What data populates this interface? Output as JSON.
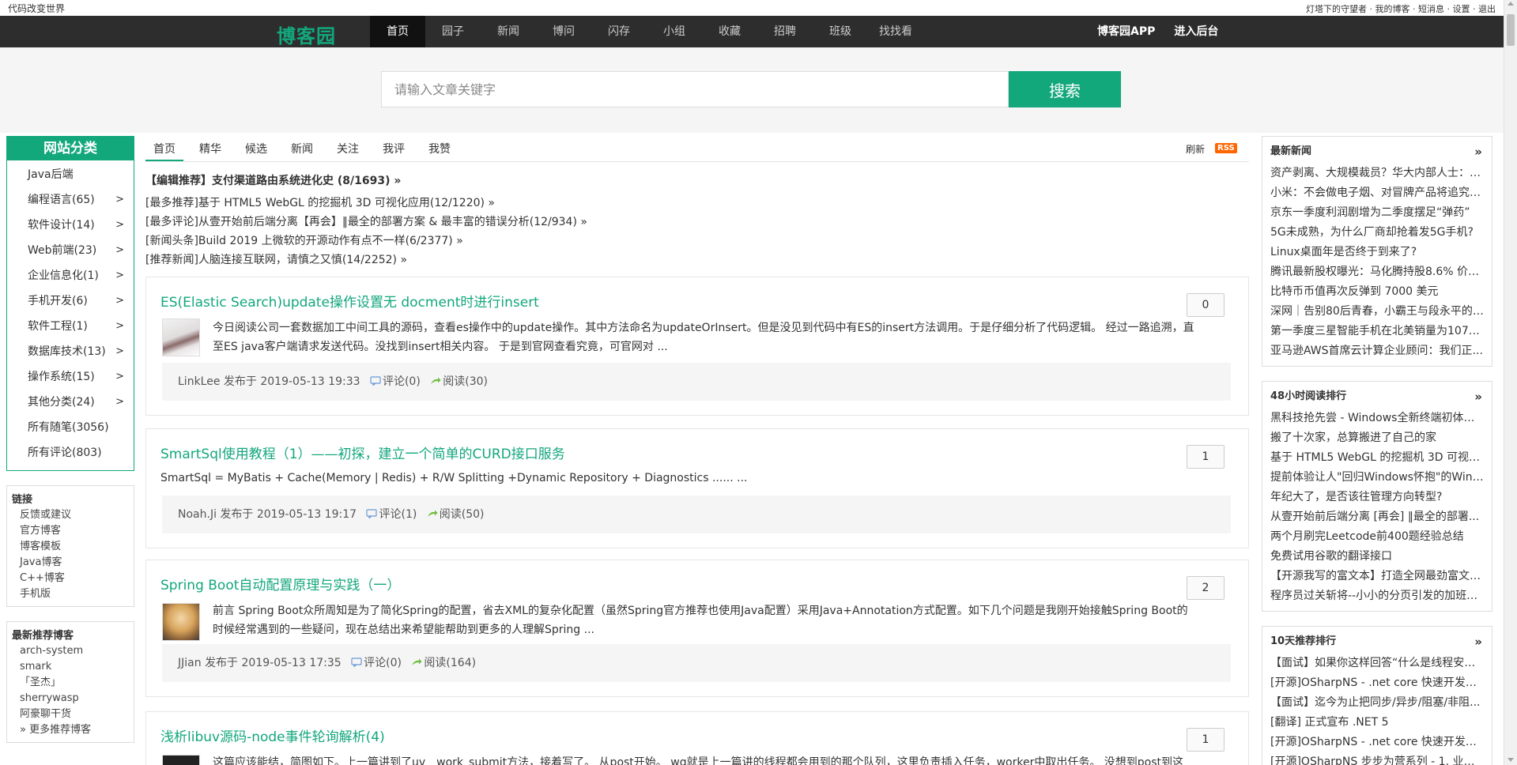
{
  "topbar": {
    "slogan": "代码改变世界",
    "user_name": "灯塔下的守望者",
    "links": [
      "我的博客",
      "短消息",
      "设置",
      "退出"
    ]
  },
  "nav": {
    "logo": "博客园",
    "items": [
      "首页",
      "园子",
      "新闻",
      "博问",
      "闪存",
      "小组",
      "收藏",
      "招聘",
      "班级",
      "找找看"
    ],
    "active_index": 0,
    "app_link": "博客园APP",
    "admin_link": "进入后台"
  },
  "search": {
    "placeholder": "请输入文章关键字",
    "button": "搜索"
  },
  "categories": {
    "title": "网站分类",
    "items": [
      {
        "label": "Java后端",
        "has_arrow": false
      },
      {
        "label": "编程语言(65)",
        "has_arrow": true
      },
      {
        "label": "软件设计(14)",
        "has_arrow": true
      },
      {
        "label": "Web前端(23)",
        "has_arrow": true
      },
      {
        "label": "企业信息化(1)",
        "has_arrow": true
      },
      {
        "label": "手机开发(6)",
        "has_arrow": true
      },
      {
        "label": "软件工程(1)",
        "has_arrow": true
      },
      {
        "label": "数据库技术(13)",
        "has_arrow": true
      },
      {
        "label": "操作系统(15)",
        "has_arrow": true
      },
      {
        "label": "其他分类(24)",
        "has_arrow": true
      },
      {
        "label": "所有随笔(3056)",
        "has_arrow": false
      },
      {
        "label": "所有评论(803)",
        "has_arrow": false
      }
    ],
    "arrow": ">"
  },
  "links_box": {
    "title": "链接",
    "items": [
      "反馈或建议",
      "官方博客",
      "博客模板",
      "Java博客",
      "C++博客",
      "手机版"
    ]
  },
  "recommend_bloggers": {
    "title": "最新推荐博客",
    "items": [
      "arch-system",
      "smark",
      "「圣杰」",
      "sherrywasp",
      "阿豪聊干货",
      "» 更多推荐博客"
    ]
  },
  "tabs": {
    "items": [
      "首页",
      "精华",
      "候选",
      "新闻",
      "关注",
      "我评",
      "我赞"
    ],
    "active_index": 0,
    "refresh": "刷新",
    "rss": "RSS"
  },
  "headlines": [
    "【编辑推荐】支付渠道路由系统进化史 (8/1693) »",
    "[最多推荐]基于 HTML5 WebGL 的挖掘机 3D 可视化应用(12/1220) »",
    "[最多评论]从壹开始前后端分离【再会】‖最全的部署方案 & 最丰富的错误分析(12/934) »",
    "[新闻头条]Build 2019 上微软的开源动作有点不一样(6/2377) »",
    "[推荐新闻]人脑连接互联网，请慎之又慎(14/2252) »"
  ],
  "posts": [
    {
      "title": "ES(Elastic Search)update操作设置无 docment时进行insert",
      "digg": "0",
      "summary_lines": [
        "今日阅读公司一套数据加工中间工具的源码，查看es操作中的update操作。其中方法命名为updateOrInsert。但是没见到代码中有ES的insert方法调用。于是仔细分析了代码逻辑。 经过一路追溯，直",
        "至ES java客户端请求发送代码。没找到insert相关内容。 于是到官网查看究竟，可官网对 ..."
      ],
      "author": "LinkLee",
      "posted": "发布于 2019-05-13 19:33",
      "comments": "评论(0)",
      "reads": "阅读(30)"
    },
    {
      "title": "SmartSql使用教程（1）——初探，建立一个简单的CURD接口服务",
      "digg": "1",
      "summary_lines": [
        "SmartSql = MyBatis + Cache(Memory | Redis) + R/W Splitting +Dynamic Repository + Diagnostics ...... ..."
      ],
      "author": "Noah.Ji",
      "posted": "发布于 2019-05-13 19:17",
      "comments": "评论(1)",
      "reads": "阅读(50)"
    },
    {
      "title": "Spring Boot自动配置原理与实践（一）",
      "digg": "2",
      "summary_lines": [
        "前言 Spring Boot众所周知是为了简化Spring的配置，省去XML的复杂化配置（虽然Spring官方推荐也使用Java配置）采用Java+Annotation方式配置。如下几个问题是我刚开始接触Spring Boot的",
        "时候经常遇到的一些疑问，现在总结出来希望能帮助到更多的人理解Spring ..."
      ],
      "author": "JJian",
      "posted": "发布于 2019-05-13 17:35",
      "comments": "评论(0)",
      "reads": "阅读(164)"
    },
    {
      "title": "浅析libuv源码-node事件轮询解析(4)",
      "digg": "1",
      "summary_lines": [
        "这篇应该能结，简图如下。上一篇讲到了uv__work_submit方法，接着写了。 从post开始。 wq就是上一篇讲的线程都会用到的那个队列，这里负责插入任务，worker中取出任务。 没想到post到这"
      ],
      "author": "",
      "posted": "",
      "comments": "",
      "reads": ""
    }
  ],
  "right": {
    "news": {
      "title": "最新新闻",
      "more": "»",
      "items": [
        "资产剥离、大规模裁员？华大内部人士：系...",
        "小米：不会做电子烟、对冒牌产品将追究法...",
        "京东一季度利润剧增为二季度摆足“弹药”",
        "5G未成熟，为什么厂商却抢着发5G手机?",
        "Linux桌面年是否终于到来了?",
        "腾讯最新股权曝光：马化腾持股8.6% 价值...",
        "比特币币值再次反弹到 7000 美元",
        "深网｜告别80后青春，小霸王与段永平的传...",
        "第一季度三星智能手机在北美销量为1070...",
        "亚马逊AWS首席云计算企业顾问：我们正..."
      ]
    },
    "read_rank": {
      "title": "48小时阅读排行",
      "more": "»",
      "items": [
        "黑科技抢先尝 - Windows全新终端初体验(...",
        "搬了十次家，总算搬进了自己的家",
        "基于 HTML5 WebGL 的挖掘机 3D 可视化...",
        "提前体验让人\"回归Windows怀抱\"的Wind...",
        "年纪大了，是否该往管理方向转型?",
        "从壹开始前后端分离 [再会] ‖最全的部署...",
        "两个月刷完Leetcode前400题经验总结",
        "免费试用谷歌的翻译接口",
        "【开源我写的富文本】打造全网最劲富文本...",
        "程序员过关斩将--小小的分页引发的加班血案"
      ]
    },
    "rec_rank": {
      "title": "10天推荐排行",
      "more": "»",
      "items": [
        "【面试】如果你这样回答“什么是线程安全...",
        "[开源]OSharpNS - .net core 快速开发框架...",
        "【面试】迄今为止把同步/异步/阻塞/非阻...",
        "[翻译] 正式宣布 .NET 5",
        "[开源]OSharpNS - .net core 快速开发框架...",
        "[开源]OSharpNS 步步为营系列 - 1. 业务模..."
      ]
    }
  },
  "colors": {
    "accent": "#13a77c",
    "nav_bg": "#2d2d2d",
    "rss": "#ff6600"
  }
}
